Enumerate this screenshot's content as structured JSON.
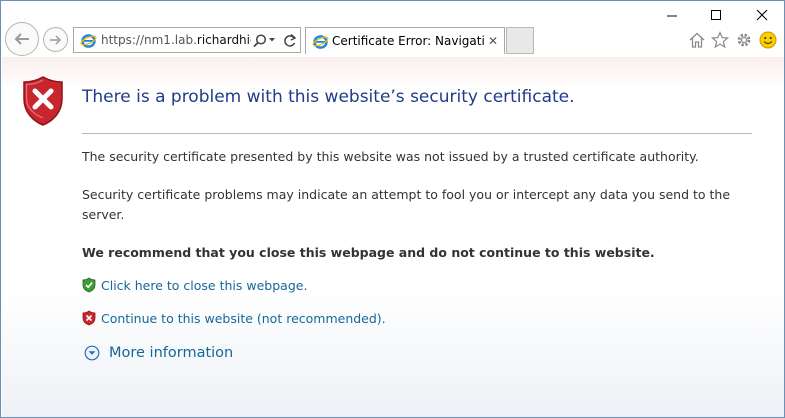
{
  "window": {
    "minimize_icon": "minimize-icon",
    "maximize_icon": "maximize-icon",
    "close_icon": "close-icon"
  },
  "toolbar": {
    "address_prefix": "https://nm1.lab.",
    "address_domain": "richardhic",
    "address_suffix": "...",
    "tab_title": "Certificate Error: Navigation...",
    "tab_close": "✕",
    "icons": [
      "back-icon",
      "forward-icon",
      "ie-logo-icon",
      "search-icon",
      "refresh-icon",
      "home-icon",
      "favorites-icon",
      "settings-icon",
      "smiley-icon"
    ]
  },
  "page": {
    "title": "There is a problem with this website’s security certificate.",
    "para1": "The security certificate presented by this website was not issued by a trusted certificate authority.",
    "para2": "Security certificate problems may indicate an attempt to fool you or intercept any data you send to the server.",
    "recommend": "We recommend that you close this webpage and do not continue to this website.",
    "close_link": "Click here to close this webpage.",
    "continue_link": "Continue to this website (not recommended).",
    "more_info": "More information"
  },
  "colors": {
    "title": "#1f3c88",
    "link": "#14689a",
    "shield_red": "#c8262c",
    "shield_green": "#3f9b35"
  }
}
